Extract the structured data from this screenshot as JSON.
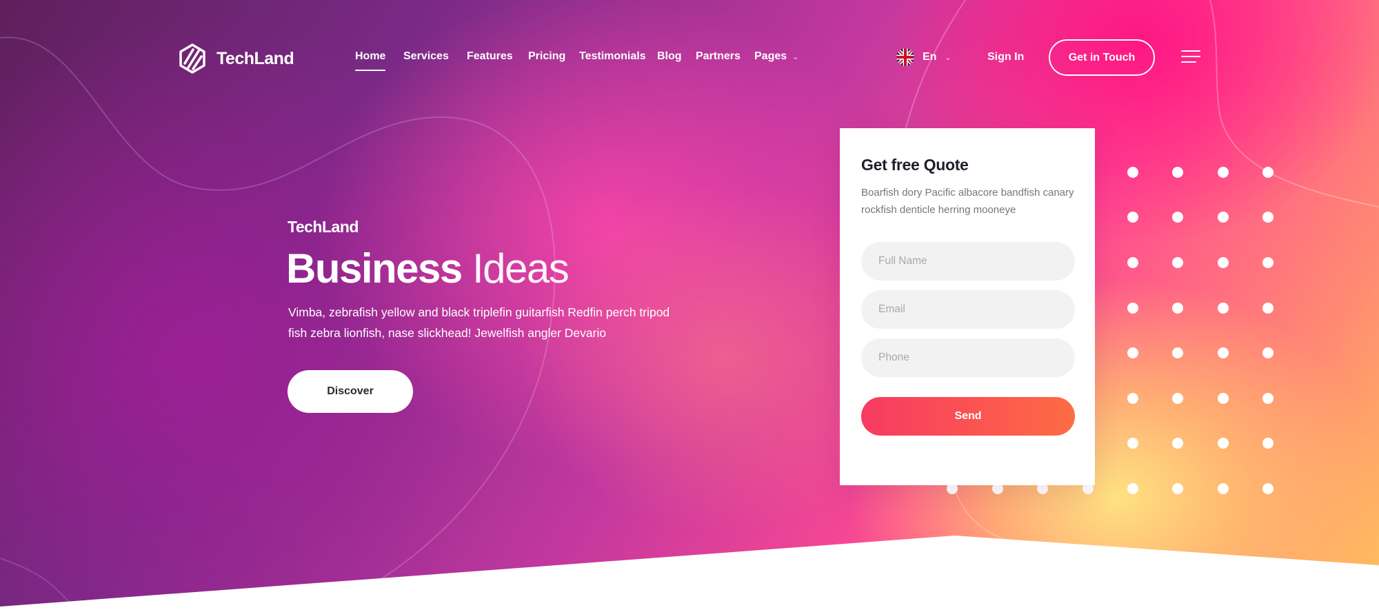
{
  "brand": {
    "name": "TechLand",
    "logo_icon": "techland-hexagon-logo-icon"
  },
  "nav": {
    "items": [
      {
        "label": "Home",
        "active": true
      },
      {
        "label": "Services"
      },
      {
        "label": "Features"
      },
      {
        "label": "Pricing"
      },
      {
        "label": "Testimonials"
      },
      {
        "label": "Blog"
      },
      {
        "label": "Partners"
      },
      {
        "label": "Pages",
        "has_dropdown": true
      }
    ]
  },
  "header": {
    "language": "En",
    "language_flag": "uk-flag-icon",
    "sign_in": "Sign In",
    "cta": "Get in Touch",
    "menu_icon": "hamburger-icon"
  },
  "hero": {
    "eyebrow": "TechLand",
    "title_bold": "Business",
    "title_light": "Ideas",
    "description": "Vimba, zebrafish yellow and black triplefin guitarfish Redfin perch tripod fish zebra lionfish, nase slickhead! Jewelfish angler Devario",
    "button": "Discover"
  },
  "quote_form": {
    "title": "Get free Quote",
    "text": "Boarfish dory Pacific albacore bandfish canary rockfish denticle herring mooneye",
    "fields": [
      {
        "placeholder": "Full Name",
        "value": ""
      },
      {
        "placeholder": "Email",
        "value": ""
      },
      {
        "placeholder": "Phone",
        "value": ""
      }
    ],
    "submit": "Send"
  },
  "colors": {
    "purple_dark": "#5f1f5c",
    "magenta": "#ff1a8c",
    "pink": "#ff4a92",
    "yellow": "#ffe07a",
    "send_start": "#f73a63",
    "send_end": "#fd6c44",
    "white": "#ffffff"
  }
}
